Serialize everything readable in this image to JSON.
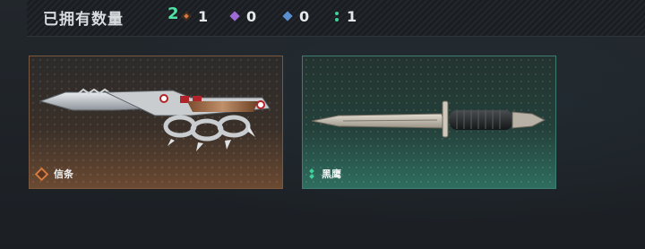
{
  "header": {
    "title": "已拥有数量",
    "owned_count": "2",
    "stats": [
      {
        "icon": "orange-diamond-icon",
        "color": "#d67a3e",
        "value": "1"
      },
      {
        "icon": "purple-diamond-icon",
        "color": "#9d6ad6",
        "value": "0"
      },
      {
        "icon": "blue-diamond-icon",
        "color": "#5a8fd0",
        "value": "0"
      },
      {
        "icon": "green-dots-icon",
        "color": "#3fd19a",
        "value": "1"
      }
    ]
  },
  "items": [
    {
      "name": "信条",
      "rarity_color": "#d67a3e"
    },
    {
      "name": "黑鹰",
      "rarity_color": "#3fd19a"
    }
  ]
}
